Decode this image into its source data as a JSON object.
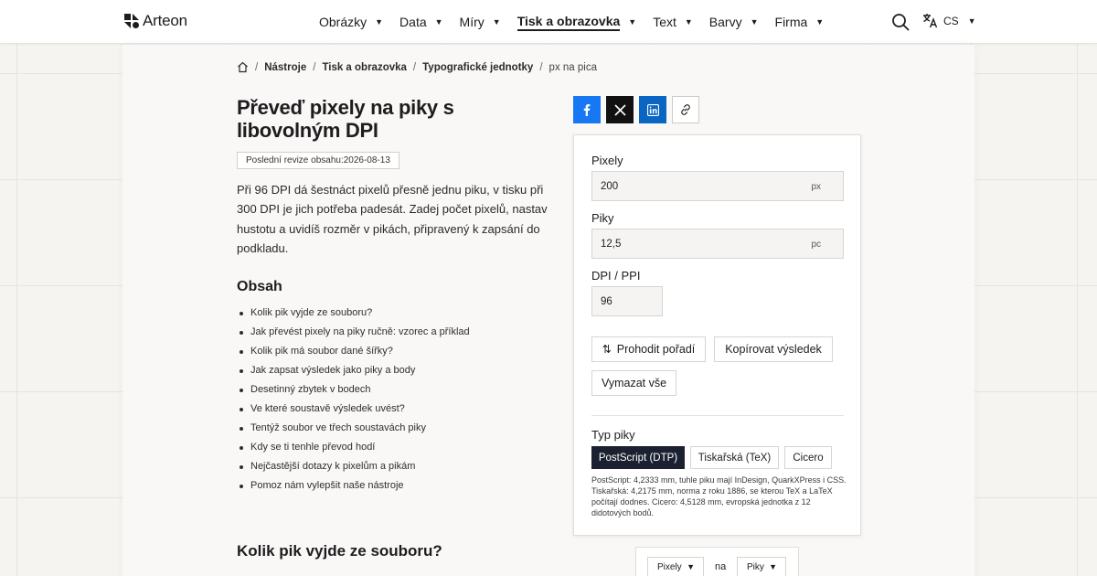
{
  "header": {
    "logo_text": "Arteon",
    "nav": [
      {
        "label": "Obrázky"
      },
      {
        "label": "Data"
      },
      {
        "label": "Míry"
      },
      {
        "label": "Tisk a obrazovka",
        "active": true
      },
      {
        "label": "Text"
      },
      {
        "label": "Barvy"
      },
      {
        "label": "Firma"
      }
    ],
    "lang": "CS"
  },
  "breadcrumb": [
    "Nástroje",
    "Tisk a obrazovka",
    "Typografické jednotky",
    "px na pica"
  ],
  "page": {
    "title": "Převeď pixely na piky s libovolným DPI",
    "revision": "Poslední revize obsahu:2026-08-13",
    "intro": "Při 96 DPI dá šestnáct pixelů přesně jednu piku, v tisku při 300 DPI je jich potřeba padesát. Zadej počet pixelů, nastav hustotu a uvidíš rozměr v pikách, připravený k zapsání do podkladu.",
    "toc_title": "Obsah",
    "toc": [
      "Kolik pik vyjde ze souboru?",
      "Jak převést pixely na piky ručně: vzorec a příklad",
      "Kolik pik má soubor dané šířky?",
      "Jak zapsat výsledek jako piky a body",
      "Desetinný zbytek v bodech",
      "Ve které soustavě výsledek uvést?",
      "Tentýž soubor ve třech soustavách piky",
      "Kdy se ti tenhle převod hodí",
      "Nejčastější dotazy k pixelům a pikám",
      "Pomoz nám vylepšit naše nástroje"
    ],
    "section_heading": "Kolik pik vyjde ze souboru?"
  },
  "calculator": {
    "pixels_label": "Pixely",
    "pixels_value": "200",
    "pixels_unit": "px",
    "picas_label": "Piky",
    "picas_value": "12,5",
    "picas_unit": "pc",
    "dpi_label": "DPI / PPI",
    "dpi_value": "96",
    "swap_label": "Prohodit pořadí",
    "copy_label": "Kopírovat výsledek",
    "clear_label": "Vymazat vše",
    "type_label": "Typ piky",
    "types": [
      "PostScript (DTP)",
      "Tiskařská (TeX)",
      "Cicero"
    ],
    "active_type": 0,
    "note": "PostScript: 4,2333 mm, tuhle piku mají InDesign, QuarkXPress i CSS. Tiskařská: 4,2175 mm, norma z roku 1886, se kterou TeX a LaTeX počítají dodnes. Cicero: 4,5128 mm, evropská jednotka z 12 didotových bodů."
  },
  "unit_picker": {
    "from": "Pixely",
    "connector": "na",
    "to": "Piky"
  },
  "colors": {
    "facebook": "#1877f2",
    "x": "#111111",
    "linkedin": "#0a66c2",
    "active_segment": "#1b2130"
  }
}
